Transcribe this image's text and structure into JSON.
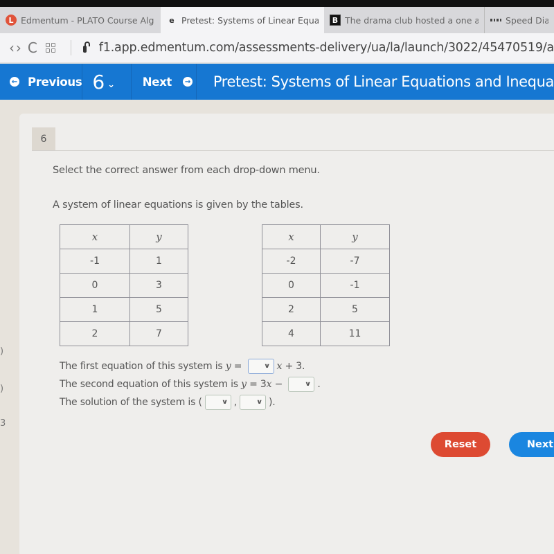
{
  "browser": {
    "tabs": [
      {
        "label": "Edmentum - PLATO Course Alg",
        "icon": "edmentum-logo-icon",
        "active": false
      },
      {
        "label": "Pretest: Systems of Linear Equa",
        "icon": "edmentum-e-icon",
        "active": true
      },
      {
        "label": "The drama club hosted a one a",
        "icon": "brainly-b-icon",
        "active": false
      },
      {
        "label": "Speed Dial",
        "icon": "speed-dial-grid-icon",
        "active": false
      }
    ],
    "nav": {
      "back": "‹",
      "forward": "›",
      "reload": "C"
    },
    "url": "f1.app.edmentum.com/assessments-delivery/ua/la/launch/3022/45470519/a"
  },
  "header": {
    "previous_label": "Previous",
    "question_number": "6",
    "next_label": "Next",
    "title": "Pretest: Systems of Linear Equations and Inequa",
    "accent_color": "#1677d2"
  },
  "question": {
    "number": "6",
    "instruction": "Select the correct answer from each drop-down menu.",
    "prompt": "A system of linear equations is given by the tables.",
    "table1": {
      "headers": [
        "x",
        "y"
      ],
      "rows": [
        [
          "-1",
          "1"
        ],
        [
          "0",
          "3"
        ],
        [
          "1",
          "5"
        ],
        [
          "2",
          "7"
        ]
      ]
    },
    "table2": {
      "headers": [
        "x",
        "y"
      ],
      "rows": [
        [
          "-2",
          "-7"
        ],
        [
          "0",
          "-1"
        ],
        [
          "2",
          "5"
        ],
        [
          "4",
          "11"
        ]
      ]
    },
    "equations": {
      "line1_prefix": "The first equation of this system is ",
      "line1_var": "y",
      "line1_eq": " = ",
      "line1_suffix_var": "x",
      "line1_suffix": " + 3.",
      "line2_prefix": "The second equation of this system is ",
      "line2_var": "y",
      "line2_eq": " = 3",
      "line2_var2": "x",
      "line2_minus": " − ",
      "line2_suffix": ".",
      "line3_prefix": "The solution of the system is (",
      "line3_comma": ",",
      "line3_suffix": ").",
      "dropdown_selected": [
        "",
        "",
        "",
        ""
      ]
    }
  },
  "actions": {
    "reset_label": "Reset",
    "next_label": "Next",
    "reset_color": "#dd4a32",
    "next_color": "#1a86e0"
  },
  "side_fragments": [
    ")",
    ")",
    "3"
  ]
}
